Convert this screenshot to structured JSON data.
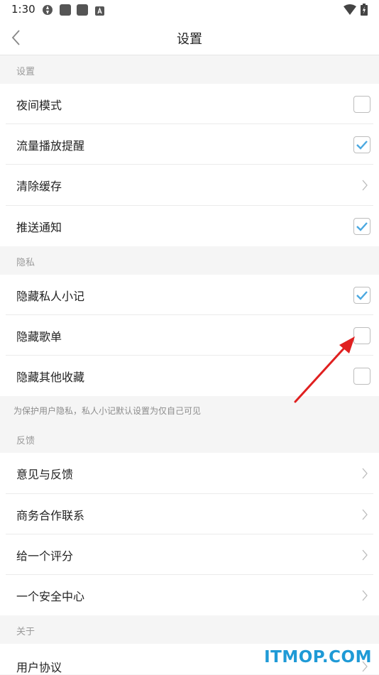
{
  "status_bar": {
    "time": "1:30",
    "icons": [
      "app-notification-icon",
      "square-icon",
      "square-icon",
      "a-icon",
      "wifi-icon",
      "battery-charging-icon"
    ]
  },
  "header": {
    "title": "设置",
    "back_icon": "back-chevron-icon"
  },
  "sections": {
    "settings": {
      "title": "设置",
      "items": [
        {
          "label": "夜间模式",
          "control": "checkbox",
          "checked": false
        },
        {
          "label": "流量播放提醒",
          "control": "checkbox",
          "checked": true
        },
        {
          "label": "清除缓存",
          "control": "chevron"
        },
        {
          "label": "推送通知",
          "control": "checkbox",
          "checked": true
        }
      ]
    },
    "privacy": {
      "title": "隐私",
      "items": [
        {
          "label": "隐藏私人小记",
          "control": "checkbox",
          "checked": true
        },
        {
          "label": "隐藏歌单",
          "control": "checkbox",
          "checked": false
        },
        {
          "label": "隐藏其他收藏",
          "control": "checkbox",
          "checked": false
        }
      ],
      "note": "为保护用户隐私，私人小记默认设置为仅自己可见"
    },
    "feedback": {
      "title": "反馈",
      "items": [
        {
          "label": "意见与反馈",
          "control": "chevron"
        },
        {
          "label": "商务合作联系",
          "control": "chevron"
        },
        {
          "label": "给一个评分",
          "control": "chevron"
        },
        {
          "label": "一个安全中心",
          "control": "chevron"
        }
      ]
    },
    "about": {
      "title": "关于",
      "items": [
        {
          "label": "用户协议",
          "control": "chevron"
        }
      ]
    }
  },
  "watermark": "ITMOP.COM",
  "colors": {
    "check_accent": "#4aa8e0",
    "annotation_arrow": "#e02020",
    "watermark": "#1f9ad6",
    "background": "#f5f5f5"
  }
}
